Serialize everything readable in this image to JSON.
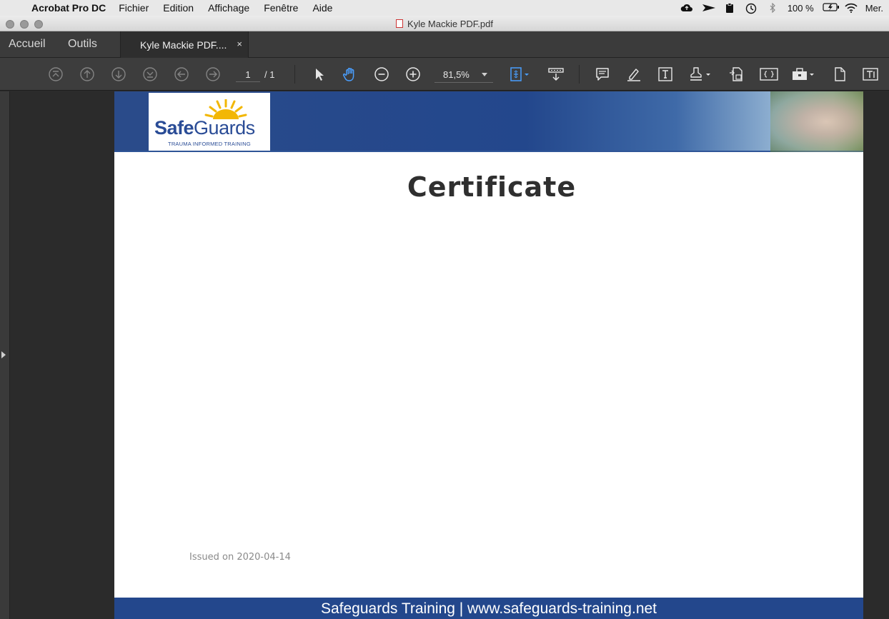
{
  "menubar": {
    "app_name": "Acrobat Pro DC",
    "items": [
      "Fichier",
      "Edition",
      "Affichage",
      "Fenêtre",
      "Aide"
    ],
    "battery": "100 %",
    "clock": "Mer."
  },
  "window": {
    "title": "Kyle Mackie PDF.pdf"
  },
  "tabs": {
    "home": "Accueil",
    "tools": "Outils",
    "document": "Kyle Mackie PDF....",
    "close": "×"
  },
  "toolbar": {
    "page_current": "1",
    "page_total": "/ 1",
    "zoom": "81,5%"
  },
  "document": {
    "logo_brand_bold": "Safe",
    "logo_brand_light": "Guards",
    "logo_tagline": "TRAUMA INFORMED TRAINING",
    "title": "Certificate",
    "issued": "Issued on 2020-04-14",
    "footer": "Safeguards Training | www.safeguards-training.net"
  },
  "colors": {
    "brand_blue": "#23478c",
    "sun_yellow": "#f2b705",
    "toolbar_bg": "#3d3d3d",
    "active_tool": "#4a9fff"
  }
}
